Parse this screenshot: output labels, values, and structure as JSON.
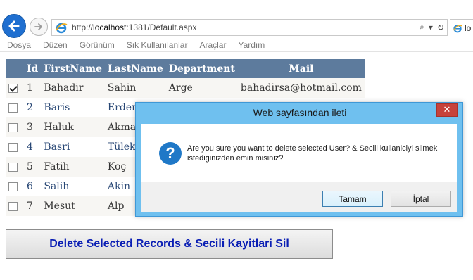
{
  "browser": {
    "url_prefix": "http://",
    "url_host": "localhost",
    "url_rest": ":1381/Default.aspx",
    "tab_label": "lo",
    "menu": [
      "Dosya",
      "Düzen",
      "Görünüm",
      "Sık Kullanılanlar",
      "Araçlar",
      "Yardım"
    ],
    "tools": {
      "search": "⌕",
      "dropdown": "▾",
      "refresh": "↻"
    }
  },
  "grid": {
    "header_color": "#5D7B9D",
    "columns": [
      "",
      "Id",
      "FirstName",
      "LastName",
      "Department",
      "Mail"
    ],
    "rows": [
      {
        "checked": true,
        "id": "1",
        "first": "Bahadir",
        "last": "Sahin",
        "dept": "Arge",
        "mail": "bahadirsa@hotmail.com"
      },
      {
        "checked": false,
        "id": "2",
        "first": "Baris",
        "last": "Erdem",
        "dept": "",
        "mail": ""
      },
      {
        "checked": false,
        "id": "3",
        "first": "Haluk",
        "last": "Akman",
        "dept": "",
        "mail": ""
      },
      {
        "checked": false,
        "id": "4",
        "first": "Basri",
        "last": "Tülek",
        "dept": "",
        "mail": ""
      },
      {
        "checked": false,
        "id": "5",
        "first": "Fatih",
        "last": "Koç",
        "dept": "",
        "mail": ""
      },
      {
        "checked": false,
        "id": "6",
        "first": "Salih",
        "last": "Akin",
        "dept": "",
        "mail": ""
      },
      {
        "checked": false,
        "id": "7",
        "first": "Mesut",
        "last": "Alp",
        "dept": "",
        "mail": ""
      }
    ]
  },
  "delete_button": {
    "label": "Delete Selected Records & Secili Kayitlari Sil"
  },
  "dialog": {
    "title": "Web sayfasından ileti",
    "close_glyph": "✕",
    "icon_glyph": "?",
    "message": "Are you sure you want to delete selected User? & Secili kullaniciyi silmek istediginizden emin misiniz?",
    "ok_label": "Tamam",
    "cancel_label": "İptal"
  }
}
